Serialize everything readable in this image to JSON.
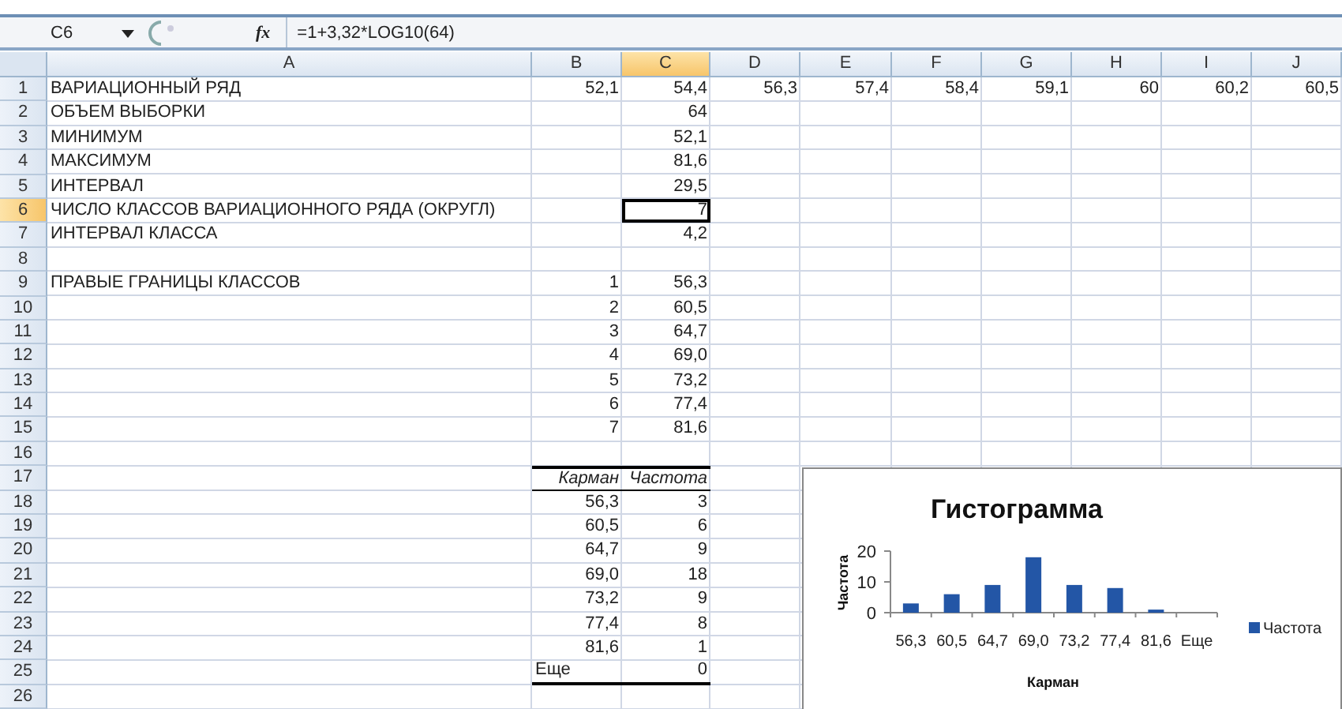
{
  "formula_bar": {
    "name_box": "C6",
    "function_label": "fx",
    "formula": "=1+3,32*LOG10(64)"
  },
  "columns": [
    {
      "label": "A",
      "selected": false
    },
    {
      "label": "B",
      "selected": false
    },
    {
      "label": "C",
      "selected": true
    },
    {
      "label": "D",
      "selected": false
    },
    {
      "label": "E",
      "selected": false
    },
    {
      "label": "F",
      "selected": false
    },
    {
      "label": "G",
      "selected": false
    },
    {
      "label": "H",
      "selected": false
    },
    {
      "label": "I",
      "selected": false
    },
    {
      "label": "J",
      "selected": false
    }
  ],
  "rows": [
    {
      "header": "1",
      "selected": false,
      "cells": {
        "A": "ВАРИАЦИОННЫЙ РЯД",
        "B": "52,1",
        "C": "54,4",
        "D": "56,3",
        "E": "57,4",
        "F": "58,4",
        "G": "59,1",
        "H": "60",
        "I": "60,2",
        "J": "60,5"
      }
    },
    {
      "header": "2",
      "selected": false,
      "cells": {
        "A": "ОБЪЕМ ВЫБОРКИ",
        "C": "64"
      }
    },
    {
      "header": "3",
      "selected": false,
      "cells": {
        "A": "МИНИМУМ",
        "C": "52,1"
      }
    },
    {
      "header": "4",
      "selected": false,
      "cells": {
        "A": "МАКСИМУМ",
        "C": "81,6"
      }
    },
    {
      "header": "5",
      "selected": false,
      "cells": {
        "A": "ИНТЕРВАЛ",
        "C": "29,5"
      }
    },
    {
      "header": "6",
      "selected": true,
      "cells": {
        "A": "ЧИСЛО КЛАССОВ ВАРИАЦИОННОГО РЯДА (ОКРУГЛ)",
        "C": "7"
      }
    },
    {
      "header": "7",
      "selected": false,
      "cells": {
        "A": "ИНТЕРВАЛ КЛАССА",
        "C": "4,2"
      }
    },
    {
      "header": "8",
      "selected": false,
      "cells": {}
    },
    {
      "header": "9",
      "selected": false,
      "cells": {
        "A": "ПРАВЫЕ ГРАНИЦЫ КЛАССОВ",
        "B": "1",
        "C": "56,3"
      }
    },
    {
      "header": "10",
      "selected": false,
      "cells": {
        "B": "2",
        "C": "60,5"
      }
    },
    {
      "header": "11",
      "selected": false,
      "cells": {
        "B": "3",
        "C": "64,7"
      }
    },
    {
      "header": "12",
      "selected": false,
      "cells": {
        "B": "4",
        "C": "69,0"
      }
    },
    {
      "header": "13",
      "selected": false,
      "cells": {
        "B": "5",
        "C": "73,2"
      }
    },
    {
      "header": "14",
      "selected": false,
      "cells": {
        "B": "6",
        "C": "77,4"
      }
    },
    {
      "header": "15",
      "selected": false,
      "cells": {
        "B": "7",
        "C": "81,6"
      }
    },
    {
      "header": "16",
      "selected": false,
      "cells": {}
    },
    {
      "header": "17",
      "selected": false,
      "kind": "table-head",
      "cells": {
        "B": "Карман",
        "C": "Частота"
      }
    },
    {
      "header": "18",
      "selected": false,
      "kind": "table-row",
      "cells": {
        "B": "56,3",
        "C": "3"
      }
    },
    {
      "header": "19",
      "selected": false,
      "kind": "table-row",
      "cells": {
        "B": "60,5",
        "C": "6"
      }
    },
    {
      "header": "20",
      "selected": false,
      "kind": "table-row",
      "cells": {
        "B": "64,7",
        "C": "9"
      }
    },
    {
      "header": "21",
      "selected": false,
      "kind": "table-row",
      "cells": {
        "B": "69,0",
        "C": "18"
      }
    },
    {
      "header": "22",
      "selected": false,
      "kind": "table-row",
      "cells": {
        "B": "73,2",
        "C": "9"
      }
    },
    {
      "header": "23",
      "selected": false,
      "kind": "table-row",
      "cells": {
        "B": "77,4",
        "C": "8"
      }
    },
    {
      "header": "24",
      "selected": false,
      "kind": "table-row",
      "cells": {
        "B": "81,6",
        "C": "1"
      }
    },
    {
      "header": "25",
      "selected": false,
      "kind": "table-end",
      "cells": {
        "B": "Еще",
        "C": "0"
      }
    },
    {
      "header": "26",
      "selected": false,
      "cells": {}
    }
  ],
  "chart": {
    "chart_data": {
      "type": "bar",
      "title": "Гистограмма",
      "xlabel": "Карман",
      "ylabel": "Частота",
      "categories": [
        "56,3",
        "60,5",
        "64,7",
        "69,0",
        "73,2",
        "77,4",
        "81,6",
        "Еще"
      ],
      "series": [
        {
          "name": "Частота",
          "color": "#2356a6",
          "values": [
            3,
            6,
            9,
            18,
            9,
            8,
            1,
            0
          ]
        }
      ],
      "ylim": [
        0,
        20
      ],
      "yticks": [
        {
          "value": 0,
          "label": "0"
        },
        {
          "value": 10,
          "label": "10"
        },
        {
          "value": 20,
          "label": "20"
        }
      ]
    }
  }
}
